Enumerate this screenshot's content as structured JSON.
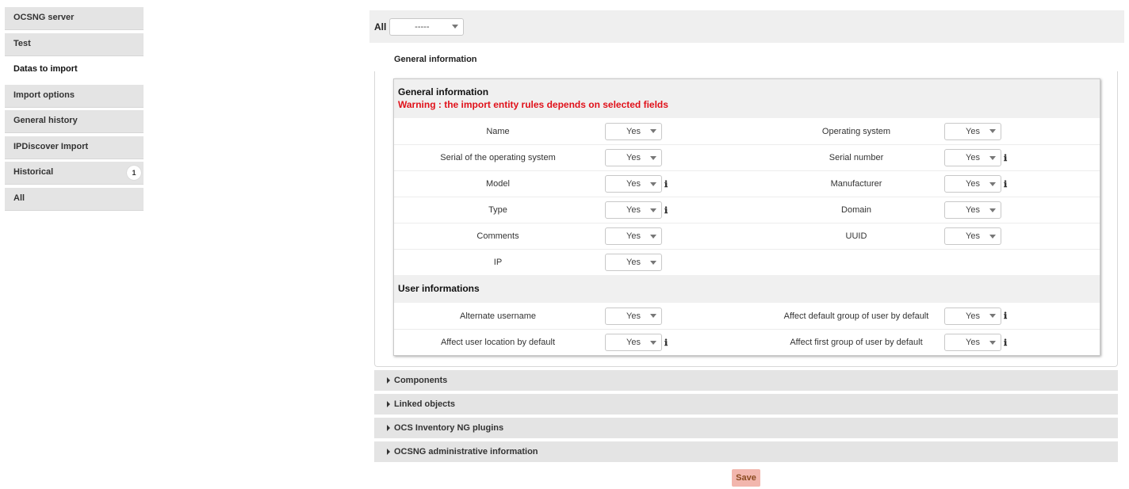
{
  "sidebar": {
    "items": [
      {
        "label": "OCSNG server"
      },
      {
        "label": "Test"
      },
      {
        "label": "Datas to import"
      },
      {
        "label": "Import options"
      },
      {
        "label": "General history"
      },
      {
        "label": "IPDiscover Import"
      },
      {
        "label": "Historical",
        "badge": "1"
      },
      {
        "label": "All"
      }
    ],
    "active_index": 2
  },
  "topbar": {
    "label": "All",
    "select_value": "-----"
  },
  "section_title": "General information",
  "general": {
    "title": "General information",
    "warning": "Warning : the import entity rules depends on selected fields",
    "rows": [
      {
        "l1": "Name",
        "v1": "Yes",
        "l2": "Operating system",
        "v2": "Yes"
      },
      {
        "l1": "Serial of the operating system",
        "v1": "Yes",
        "l2": "Serial number",
        "v2": "Yes"
      },
      {
        "l1": "Model",
        "v1": "Yes",
        "l2": "Manufacturer",
        "v2": "Yes"
      },
      {
        "l1": "Type",
        "v1": "Yes",
        "l2": "Domain",
        "v2": "Yes"
      },
      {
        "l1": "Comments",
        "v1": "Yes",
        "l2": "UUID",
        "v2": "Yes"
      },
      {
        "l1": "IP",
        "v1": "Yes"
      }
    ]
  },
  "user": {
    "title": "User informations",
    "rows": [
      {
        "l1": "Alternate username",
        "v1": "Yes",
        "l2": "Affect default group of user by default",
        "v2": "Yes"
      },
      {
        "l1": "Affect user location by default",
        "v1": "Yes",
        "l2": "Affect first group of user by default",
        "v2": "Yes"
      }
    ]
  },
  "info_glyph": "ℹ",
  "folds": [
    {
      "label": "Components"
    },
    {
      "label": "Linked objects"
    },
    {
      "label": "OCS Inventory NG plugins"
    },
    {
      "label": "OCSNG administrative information"
    }
  ],
  "save_label": "Save",
  "colors": {
    "warning": "#e0111a",
    "save_bg": "#f2b6ad",
    "panel_bg": "#efefef"
  }
}
